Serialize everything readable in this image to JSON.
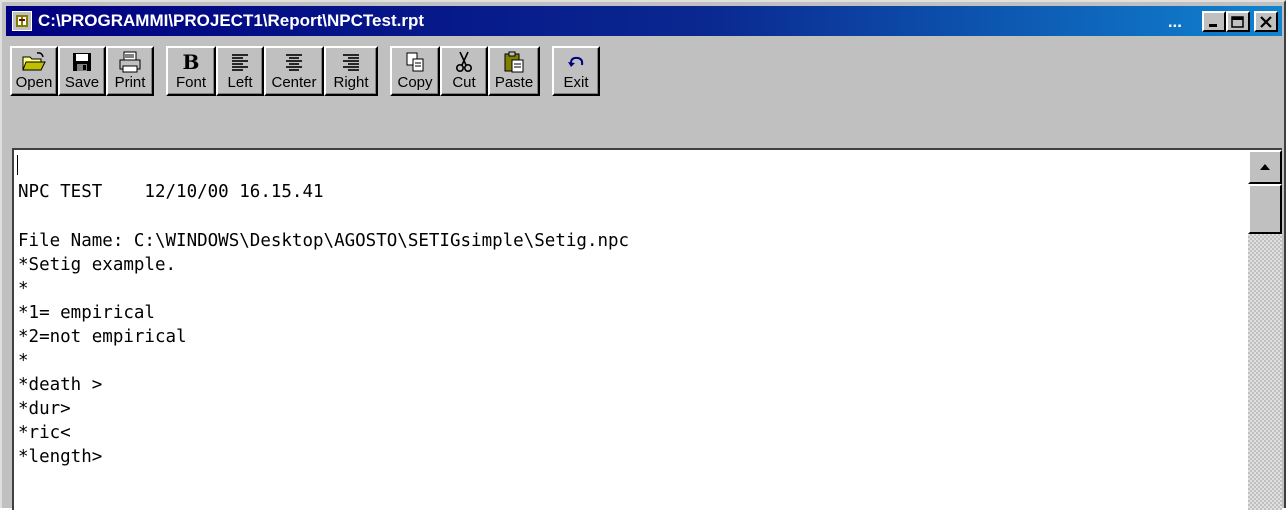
{
  "window": {
    "title": "C:\\PROGRAMMI\\PROJECT1\\Report\\NPCTest.rpt",
    "ellipsis": "...",
    "minimize_symbol": "_",
    "maximize_symbol": "□",
    "close_symbol": "✕"
  },
  "toolbar": {
    "open": {
      "label": "Open",
      "icon": "open-folder-icon"
    },
    "save": {
      "label": "Save",
      "icon": "floppy-disk-icon"
    },
    "print": {
      "label": "Print",
      "icon": "printer-icon"
    },
    "font": {
      "label": "Font",
      "icon": "bold-b-icon",
      "glyph": "B"
    },
    "left": {
      "label": "Left",
      "icon": "align-left-icon"
    },
    "center": {
      "label": "Center",
      "icon": "align-center-icon"
    },
    "right": {
      "label": "Right",
      "icon": "align-right-icon"
    },
    "copy": {
      "label": "Copy",
      "icon": "copy-icon"
    },
    "cut": {
      "label": "Cut",
      "icon": "scissors-icon"
    },
    "paste": {
      "label": "Paste",
      "icon": "clipboard-icon"
    },
    "exit": {
      "label": "Exit",
      "icon": "undo-arrow-icon"
    }
  },
  "document": {
    "lines": [
      "",
      "NPC TEST    12/10/00 16.15.41",
      "",
      "File Name: C:\\WINDOWS\\Desktop\\AGOSTO\\SETIGsimple\\Setig.npc",
      "*Setig example.",
      "*",
      "*1= empirical",
      "*2=not empirical",
      "*",
      "*death >",
      "*dur>",
      "*ric<",
      "*length>"
    ]
  },
  "colors": {
    "titlebar_start": "#000080",
    "titlebar_end": "#1084d0",
    "face": "#c0c0c0"
  }
}
